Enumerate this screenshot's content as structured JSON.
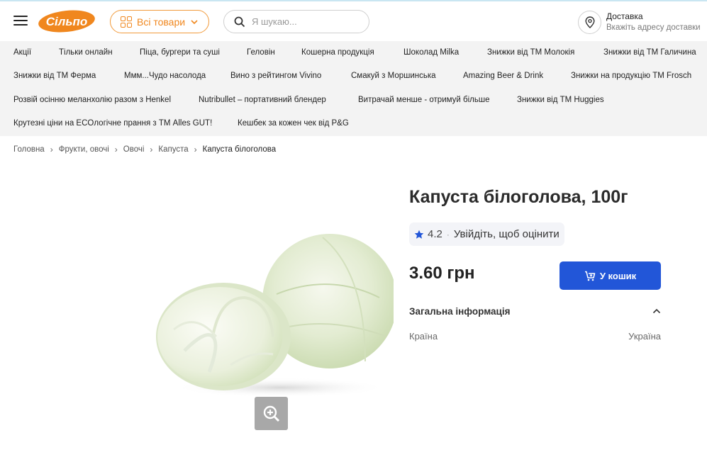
{
  "header": {
    "search_placeholder": "Я шукаю...",
    "catalog_label": "Всі товари",
    "delivery_title": "Доставка",
    "delivery_subtitle": "Вкажіть адресу доставки",
    "logo_text": "Сільпо"
  },
  "promo_links": [
    "Акції",
    "Тільки онлайн",
    "Піца, бургери та суші",
    "Геловін",
    "Кошерна продукція",
    "Шоколад Milka",
    "Знижки від ТМ Молокія",
    "Знижки від ТМ Галичина",
    "Знижки від ТМ Ферма",
    "Ммм...Чудо насолода",
    "Вино з рейтингом Vivino",
    "Смакуй з Моршинська",
    "Amazing Beer & Drink",
    "Знижки на продукцію ТМ Frosch",
    "Розвій осінню меланхолію разом з Henkel",
    "Nutribullet – портативний блендер",
    "Витрачай менше - отримуй більше",
    "Знижки від ТМ Huggies",
    "Крутезні ціни на ECOлогічне прання з ТМ Alles GUT!",
    "Кешбек за кожен чек від P&G"
  ],
  "breadcrumb": [
    "Головна",
    "Фрукти, овочі",
    "Овочі",
    "Капуста",
    "Капуста білоголова"
  ],
  "product": {
    "title": "Капуста білоголова, 100г",
    "rating": "4.2",
    "rating_login": "Увійдіть, щоб оцінити",
    "price": "3.60 грн",
    "cart_label": "У кошик",
    "section_title": "Загальна інформація",
    "info_key": "Країна",
    "info_value": "Україна"
  },
  "colors": {
    "accent_orange": "#f0871e",
    "cart_blue": "#2256d8",
    "star_blue": "#2256d8"
  },
  "icons": [
    "menu-icon",
    "grid-icon",
    "chevron-down-icon",
    "search-icon",
    "location-pin-icon",
    "star-icon",
    "cart-icon",
    "chevron-up-icon",
    "zoom-in-icon"
  ]
}
